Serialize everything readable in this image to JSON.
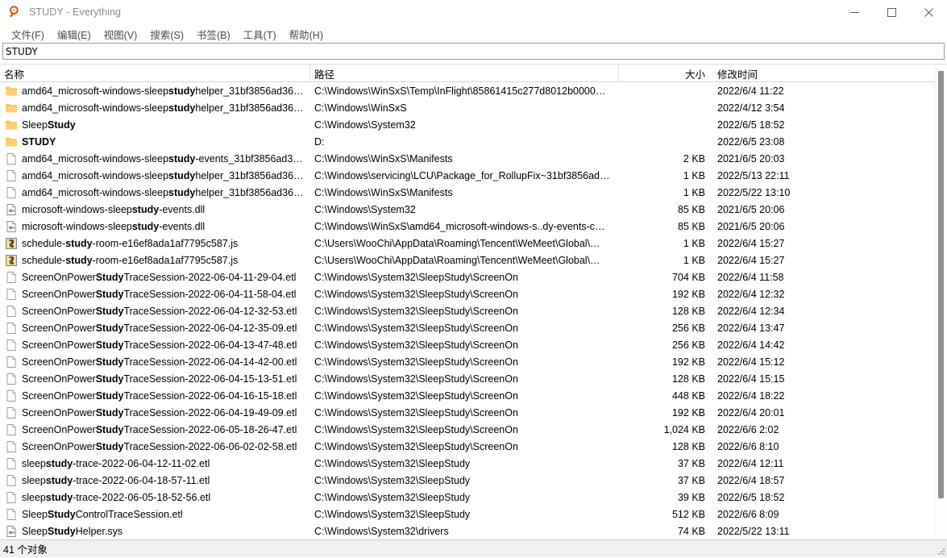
{
  "window": {
    "title": "STUDY - Everything",
    "app_icon": "magnifier-icon",
    "controls": {
      "minimize": "Minimize",
      "maximize": "Maximize",
      "close": "Close"
    }
  },
  "menubar": {
    "items": [
      {
        "label": "文件(F)"
      },
      {
        "label": "编辑(E)"
      },
      {
        "label": "视图(V)"
      },
      {
        "label": "搜索(S)"
      },
      {
        "label": "书签(B)"
      },
      {
        "label": "工具(T)"
      },
      {
        "label": "帮助(H)"
      }
    ]
  },
  "search": {
    "value": "STUDY",
    "placeholder": ""
  },
  "columns": {
    "name": "名称",
    "path": "路径",
    "size": "大小",
    "date": "修改时间"
  },
  "rows": [
    {
      "icon": "folder-icon",
      "pre": "amd64_microsoft-windows-sleep",
      "match": "study",
      "post": "helper_31bf3856ad36…",
      "bold_all": false,
      "path": "C:\\Windows\\WinSxS\\Temp\\InFlight\\85861415c277d8012b0000…",
      "size": "",
      "date": "2022/6/4 11:22"
    },
    {
      "icon": "folder-icon",
      "pre": "amd64_microsoft-windows-sleep",
      "match": "study",
      "post": "helper_31bf3856ad36…",
      "bold_all": false,
      "path": "C:\\Windows\\WinSxS",
      "size": "",
      "date": "2022/4/12 3:54"
    },
    {
      "icon": "folder-icon",
      "pre": "Sleep",
      "match": "Study",
      "post": "",
      "bold_all": false,
      "path": "C:\\Windows\\System32",
      "size": "",
      "date": "2022/6/5 18:52"
    },
    {
      "icon": "folder-icon",
      "pre": "",
      "match": "STUDY",
      "post": "",
      "bold_all": true,
      "path": "D:",
      "size": "",
      "date": "2022/6/5 23:08"
    },
    {
      "icon": "file-icon",
      "pre": "amd64_microsoft-windows-sleep",
      "match": "study",
      "post": "-events_31bf3856ad3…",
      "bold_all": false,
      "path": "C:\\Windows\\WinSxS\\Manifests",
      "size": "2 KB",
      "date": "2021/6/5 20:03"
    },
    {
      "icon": "file-icon",
      "pre": "amd64_microsoft-windows-sleep",
      "match": "study",
      "post": "helper_31bf3856ad36…",
      "bold_all": false,
      "path": "C:\\Windows\\servicing\\LCU\\Package_for_RollupFix~31bf3856ad…",
      "size": "1 KB",
      "date": "2022/5/13 22:11"
    },
    {
      "icon": "file-icon",
      "pre": "amd64_microsoft-windows-sleep",
      "match": "study",
      "post": "helper_31bf3856ad36…",
      "bold_all": false,
      "path": "C:\\Windows\\WinSxS\\Manifests",
      "size": "1 KB",
      "date": "2022/5/22 13:10"
    },
    {
      "icon": "dll-icon",
      "pre": "microsoft-windows-sleep",
      "match": "study",
      "post": "-events.dll",
      "bold_all": false,
      "path": "C:\\Windows\\System32",
      "size": "85 KB",
      "date": "2021/6/5 20:06"
    },
    {
      "icon": "dll-icon",
      "pre": "microsoft-windows-sleep",
      "match": "study",
      "post": "-events.dll",
      "bold_all": false,
      "path": "C:\\Windows\\WinSxS\\amd64_microsoft-windows-s..dy-events-c…",
      "size": "85 KB",
      "date": "2021/6/5 20:06"
    },
    {
      "icon": "js-icon",
      "pre": "schedule-",
      "match": "study",
      "post": "-room-e16ef8ada1af7795c587.js",
      "bold_all": false,
      "path": "C:\\Users\\WooChi\\AppData\\Roaming\\Tencent\\WeMeet\\Global\\…",
      "size": "1 KB",
      "date": "2022/6/4 15:27"
    },
    {
      "icon": "js-icon",
      "pre": "schedule-",
      "match": "study",
      "post": "-room-e16ef8ada1af7795c587.js",
      "bold_all": false,
      "path": "C:\\Users\\WooChi\\AppData\\Roaming\\Tencent\\WeMeet\\Global\\…",
      "size": "1 KB",
      "date": "2022/6/4 15:27"
    },
    {
      "icon": "file-icon",
      "pre": "ScreenOnPower",
      "match": "Study",
      "post": "TraceSession-2022-06-04-11-29-04.etl",
      "bold_all": false,
      "path": "C:\\Windows\\System32\\SleepStudy\\ScreenOn",
      "size": "704 KB",
      "date": "2022/6/4 11:58"
    },
    {
      "icon": "file-icon",
      "pre": "ScreenOnPower",
      "match": "Study",
      "post": "TraceSession-2022-06-04-11-58-04.etl",
      "bold_all": false,
      "path": "C:\\Windows\\System32\\SleepStudy\\ScreenOn",
      "size": "192 KB",
      "date": "2022/6/4 12:32"
    },
    {
      "icon": "file-icon",
      "pre": "ScreenOnPower",
      "match": "Study",
      "post": "TraceSession-2022-06-04-12-32-53.etl",
      "bold_all": false,
      "path": "C:\\Windows\\System32\\SleepStudy\\ScreenOn",
      "size": "128 KB",
      "date": "2022/6/4 12:34"
    },
    {
      "icon": "file-icon",
      "pre": "ScreenOnPower",
      "match": "Study",
      "post": "TraceSession-2022-06-04-12-35-09.etl",
      "bold_all": false,
      "path": "C:\\Windows\\System32\\SleepStudy\\ScreenOn",
      "size": "256 KB",
      "date": "2022/6/4 13:47"
    },
    {
      "icon": "file-icon",
      "pre": "ScreenOnPower",
      "match": "Study",
      "post": "TraceSession-2022-06-04-13-47-48.etl",
      "bold_all": false,
      "path": "C:\\Windows\\System32\\SleepStudy\\ScreenOn",
      "size": "256 KB",
      "date": "2022/6/4 14:42"
    },
    {
      "icon": "file-icon",
      "pre": "ScreenOnPower",
      "match": "Study",
      "post": "TraceSession-2022-06-04-14-42-00.etl",
      "bold_all": false,
      "path": "C:\\Windows\\System32\\SleepStudy\\ScreenOn",
      "size": "192 KB",
      "date": "2022/6/4 15:12"
    },
    {
      "icon": "file-icon",
      "pre": "ScreenOnPower",
      "match": "Study",
      "post": "TraceSession-2022-06-04-15-13-51.etl",
      "bold_all": false,
      "path": "C:\\Windows\\System32\\SleepStudy\\ScreenOn",
      "size": "128 KB",
      "date": "2022/6/4 15:15"
    },
    {
      "icon": "file-icon",
      "pre": "ScreenOnPower",
      "match": "Study",
      "post": "TraceSession-2022-06-04-16-15-18.etl",
      "bold_all": false,
      "path": "C:\\Windows\\System32\\SleepStudy\\ScreenOn",
      "size": "448 KB",
      "date": "2022/6/4 18:22"
    },
    {
      "icon": "file-icon",
      "pre": "ScreenOnPower",
      "match": "Study",
      "post": "TraceSession-2022-06-04-19-49-09.etl",
      "bold_all": false,
      "path": "C:\\Windows\\System32\\SleepStudy\\ScreenOn",
      "size": "192 KB",
      "date": "2022/6/4 20:01"
    },
    {
      "icon": "file-icon",
      "pre": "ScreenOnPower",
      "match": "Study",
      "post": "TraceSession-2022-06-05-18-26-47.etl",
      "bold_all": false,
      "path": "C:\\Windows\\System32\\SleepStudy\\ScreenOn",
      "size": "1,024 KB",
      "date": "2022/6/6 2:02"
    },
    {
      "icon": "file-icon",
      "pre": "ScreenOnPower",
      "match": "Study",
      "post": "TraceSession-2022-06-06-02-02-58.etl",
      "bold_all": false,
      "path": "C:\\Windows\\System32\\SleepStudy\\ScreenOn",
      "size": "128 KB",
      "date": "2022/6/6 8:10"
    },
    {
      "icon": "file-icon",
      "pre": "sleep",
      "match": "study",
      "post": "-trace-2022-06-04-12-11-02.etl",
      "bold_all": false,
      "path": "C:\\Windows\\System32\\SleepStudy",
      "size": "37 KB",
      "date": "2022/6/4 12:11"
    },
    {
      "icon": "file-icon",
      "pre": "sleep",
      "match": "study",
      "post": "-trace-2022-06-04-18-57-11.etl",
      "bold_all": false,
      "path": "C:\\Windows\\System32\\SleepStudy",
      "size": "37 KB",
      "date": "2022/6/4 18:57"
    },
    {
      "icon": "file-icon",
      "pre": "sleep",
      "match": "study",
      "post": "-trace-2022-06-05-18-52-56.etl",
      "bold_all": false,
      "path": "C:\\Windows\\System32\\SleepStudy",
      "size": "39 KB",
      "date": "2022/6/5 18:52"
    },
    {
      "icon": "file-icon",
      "pre": "Sleep",
      "match": "Study",
      "post": "ControlTraceSession.etl",
      "bold_all": false,
      "path": "C:\\Windows\\System32\\SleepStudy",
      "size": "512 KB",
      "date": "2022/6/6 8:09"
    },
    {
      "icon": "dll-icon",
      "pre": "Sleep",
      "match": "Study",
      "post": "Helper.sys",
      "bold_all": false,
      "path": "C:\\Windows\\System32\\drivers",
      "size": "74 KB",
      "date": "2022/5/22 13:11"
    }
  ],
  "statusbar": {
    "count_text": "41 个对象"
  },
  "colors": {
    "folder": "#F8C447",
    "folder_dark": "#E9A931",
    "accent": "#E8540E",
    "scroll_thumb": "#8F8F8F",
    "status_bg": "#F0F0F0"
  }
}
